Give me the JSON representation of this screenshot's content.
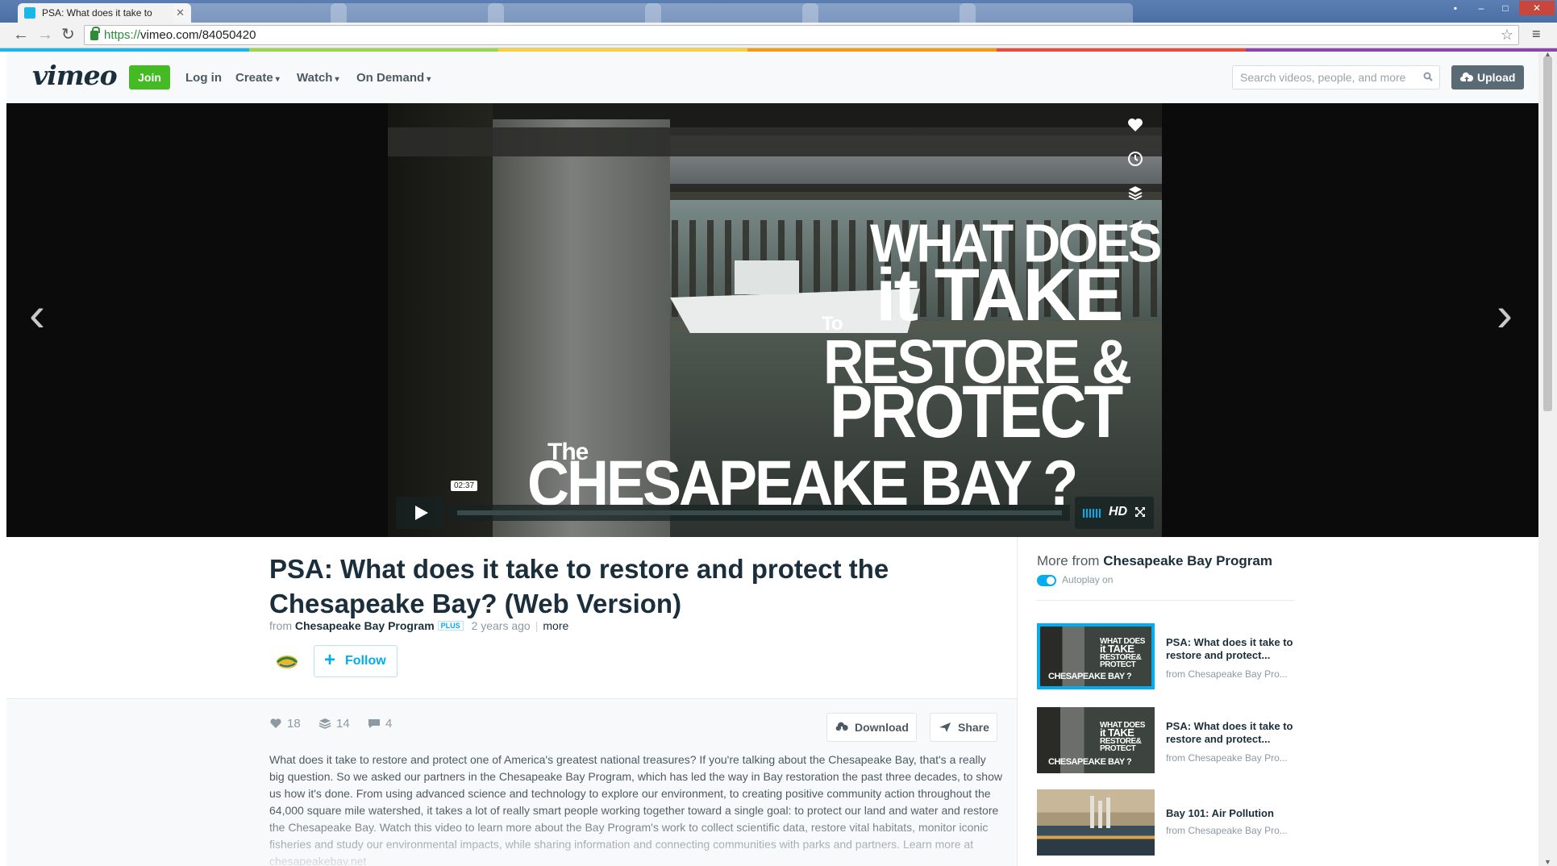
{
  "browser": {
    "active_tab_title": "PSA: What does it take to",
    "url_scheme": "https://",
    "url_rest": "vimeo.com/84050420"
  },
  "header": {
    "logo": "vimeo",
    "join": "Join",
    "login": "Log in",
    "nav": [
      "Create",
      "Watch",
      "On Demand"
    ],
    "search_placeholder": "Search videos, people, and more",
    "upload": "Upload"
  },
  "player": {
    "time": "02:37",
    "hd": "HD",
    "overlay": {
      "line1": "WHAT DOES",
      "line2": "it TAKE",
      "line3": "To",
      "line4": "RESTORE &",
      "line5": "PROTECT",
      "line6": "The",
      "line7": "CHESAPEAKE BAY ?"
    }
  },
  "video": {
    "title": "PSA: What does it take to restore and protect the Chesapeake Bay? (Web Version)",
    "from": "from",
    "owner": "Chesapeake Bay Program",
    "badge": "PLUS",
    "age": "2 years ago",
    "more": "more",
    "follow": "Follow",
    "likes": "18",
    "collections": "14",
    "comments": "4",
    "download": "Download",
    "share": "Share",
    "description": "What does it take to restore and protect one of America's greatest national treasures? If you're talking about the Chesapeake Bay, that's a really big question. So we asked our partners in the Chesapeake Bay Program, which has led the way in Bay restoration the past three decades, to show us how it's done. From using advanced science and technology to explore our environment, to creating positive community action throughout the 64,000 square mile watershed, it takes a lot of really smart people working together toward a single goal: to protect our land and water and restore the Chesapeake Bay. Watch this video to learn more about the Bay Program's work to collect scientific data, restore vital habitats, monitor iconic fisheries and study our environmental impacts, while sharing information and connecting communities with parks and partners. Learn more at chesapeakebay.net"
  },
  "sidebar": {
    "title_prefix": "More from",
    "title_owner": "Chesapeake Bay Program",
    "autoplay": "Autoplay on",
    "items": [
      {
        "title": "PSA: What does it take to restore and protect...",
        "from": "from Chesapeake Bay Pro..."
      },
      {
        "title": "PSA: What does it take to restore and protect...",
        "from": "from Chesapeake Bay Pro..."
      },
      {
        "title": "Bay 101: Air Pollution",
        "from": "from Chesapeake Bay Pro..."
      }
    ]
  },
  "colors": {
    "accent": "#00adef",
    "join": "#44bb22",
    "upload": "#5b6b76"
  }
}
